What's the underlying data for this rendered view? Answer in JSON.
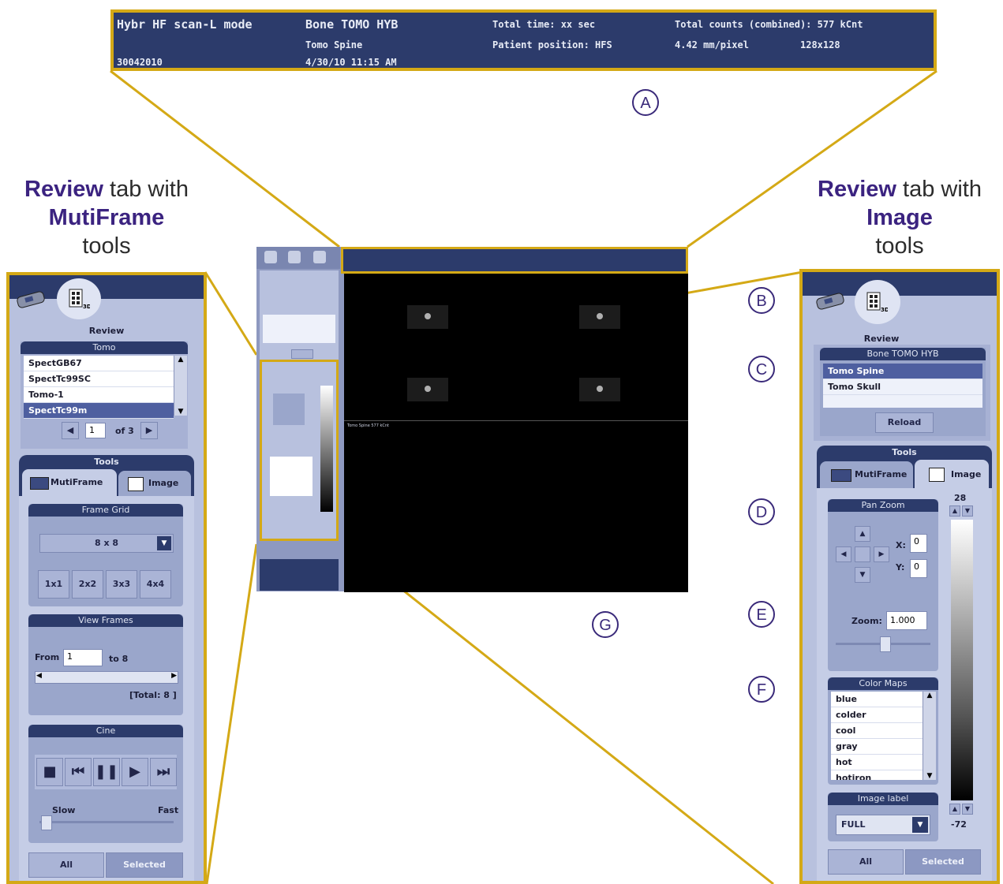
{
  "header_bar": {
    "mode": "Hybr HF scan-L mode",
    "id": "30042010",
    "study": "Bone TOMO HYB",
    "series": "Tomo Spine",
    "datetime": "4/30/10 11:15 AM",
    "total_time": "Total time: xx sec",
    "patient_position": "Patient position: HFS",
    "total_counts": "Total counts (combined): 577 kCnt",
    "pixel_size": "4.42 mm/pixel",
    "matrix": "128x128"
  },
  "headings": {
    "left": {
      "bold": "Review",
      "text": " tab with",
      "bold2": "MutiFrame",
      "text2": "tools"
    },
    "right": {
      "bold": "Review",
      "text": " tab with",
      "bold2": "Image",
      "text2": "tools"
    }
  },
  "callouts": [
    "A",
    "B",
    "C",
    "D",
    "E",
    "F",
    "G"
  ],
  "left_panel": {
    "review_label": "Review",
    "tomo_label": "Tomo",
    "tomo_items": [
      "SpectGB67",
      "SpectTc99SC",
      "Tomo-1",
      "SpectTc99m"
    ],
    "page_value": "1",
    "page_of": "of 3",
    "tools_label": "Tools",
    "tab_multiframe": "MutiFrame",
    "tab_image": "Image",
    "frame_grid_label": "Frame Grid",
    "grid_select": "8 x 8",
    "grid_buttons": [
      "1x1",
      "2x2",
      "3x3",
      "4x4"
    ],
    "view_frames_label": "View Frames",
    "from_label": "From",
    "from_value": "1",
    "to_label": "to 8",
    "total_label": "[Total: 8 ]",
    "cine_label": "Cine",
    "slow_label": "Slow",
    "fast_label": "Fast",
    "all_button": "All",
    "selected_button": "Selected"
  },
  "right_panel": {
    "review_label": "Review",
    "study_label": "Bone TOMO HYB",
    "series_items": [
      "Tomo Spine",
      "Tomo Skull"
    ],
    "reload_button": "Reload",
    "tools_label": "Tools",
    "tab_multiframe": "MutiFrame",
    "tab_image": "Image",
    "pan_zoom_label": "Pan Zoom",
    "x_label": "X:",
    "x_value": "0",
    "y_label": "Y:",
    "y_value": "0",
    "zoom_label": "Zoom:",
    "zoom_value": "1.000",
    "color_maps_label": "Color Maps",
    "color_maps": [
      "blue",
      "colder",
      "cool",
      "gray",
      "hot",
      "hotiron"
    ],
    "image_label_label": "Image label",
    "image_label_value": "FULL",
    "lut_top": "28",
    "lut_bottom": "-72",
    "all_button": "All",
    "selected_button": "Selected"
  },
  "center_screen": {
    "status_label": "Tomo Spine 577 kCnt"
  }
}
